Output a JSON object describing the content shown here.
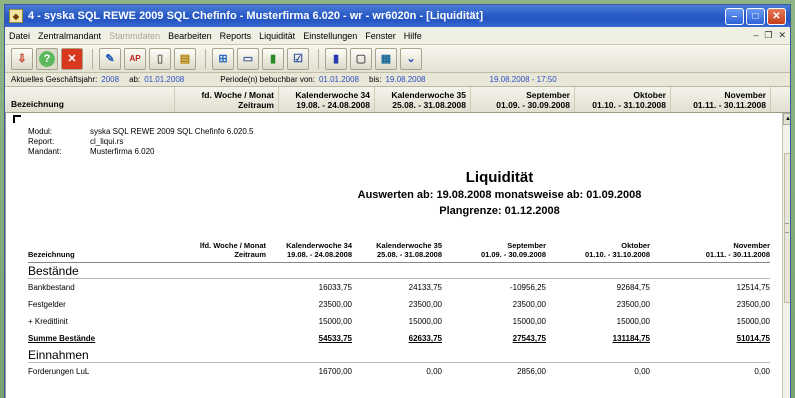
{
  "window": {
    "title": "4 - syska SQL REWE 2009 SQL Chefinfo - Musterfirma 6.020 - wr - wr6020n - [Liquidität]"
  },
  "menu": {
    "items": [
      "Datei",
      "Zentralmandant",
      "Stammdaten",
      "Bearbeiten",
      "Reports",
      "Liquidität",
      "Einstellungen",
      "Fenster",
      "Hilfe"
    ],
    "disabled_index": 2
  },
  "toolbar": {
    "icons": [
      "export-icon",
      "help-icon",
      "close-x-icon",
      "chart-pen-icon",
      "ap-icon",
      "doc-icon",
      "note-icon",
      "grid-icon",
      "window-icon",
      "bar-chart-icon",
      "checkbox-icon",
      "column-icon",
      "page-icon",
      "table-icon",
      "dropdown-circle-icon"
    ]
  },
  "status": {
    "geschaeftsjahr_label": "Aktuelles Geschäftsjahr:",
    "geschaeftsjahr": "2008",
    "ab_label": "ab:",
    "ab": "01.01.2008",
    "periode_label": "Periode(n) bebuchbar von:",
    "periode_von": "01.01.2008",
    "bis_label": "bis:",
    "periode_bis": "19.08.2008",
    "timestamp": "19.08.2008 - 17:50"
  },
  "grid_header": {
    "first": "Bezeichnung",
    "cols": [
      {
        "line1": "fd. Woche / Monat",
        "line2": "Zeitraum"
      },
      {
        "line1": "Kalenderwoche 34",
        "line2": "19.08. - 24.08.2008"
      },
      {
        "line1": "Kalenderwoche 35",
        "line2": "25.08. - 31.08.2008"
      },
      {
        "line1": "September",
        "line2": "01.09. - 30.09.2008"
      },
      {
        "line1": "Oktober",
        "line2": "01.10. - 31.10.2008"
      },
      {
        "line1": "November",
        "line2": "01.11. - 30.11.2008"
      }
    ]
  },
  "report": {
    "meta": {
      "modul_label": "Modul:",
      "modul": "syska SQL REWE 2009 SQL Chefinfo 6.020.5",
      "report_label": "Report:",
      "report": "cl_liqui.rs",
      "mandant_label": "Mandant:",
      "mandant": "Musterfirma 6.020"
    },
    "title": "Liquidität",
    "subtitle": "Auswerten ab: 19.08.2008 monatsweise ab: 01.09.2008",
    "plangrenze": "Plangrenze: 01.12.2008",
    "table_header": {
      "first": "Bezeichnung",
      "cols": [
        {
          "line1": "lfd. Woche / Monat",
          "line2": "Zeitraum"
        },
        {
          "line1": "Kalenderwoche 34",
          "line2": "19.08. - 24.08.2008"
        },
        {
          "line1": "Kalenderwoche 35",
          "line2": "25.08. - 31.08.2008"
        },
        {
          "line1": "September",
          "line2": "01.09. - 30.09.2008"
        },
        {
          "line1": "Oktober",
          "line2": "01.10. - 31.10.2008"
        },
        {
          "line1": "November",
          "line2": "01.11. - 30.11.2008"
        }
      ]
    },
    "sections": [
      {
        "name": "Bestände",
        "rows": [
          {
            "label": "Bankbestand",
            "values": [
              "",
              "16033,75",
              "24133,75",
              "-10956,25",
              "92684,75",
              "12514,75"
            ]
          },
          {
            "label": "Festgelder",
            "values": [
              "",
              "23500,00",
              "23500,00",
              "23500,00",
              "23500,00",
              "23500,00"
            ]
          },
          {
            "label": "+ Kreditlinit",
            "values": [
              "",
              "15000,00",
              "15000,00",
              "15000,00",
              "15000,00",
              "15000,00"
            ]
          }
        ],
        "sum": {
          "label": "Summe Bestände",
          "values": [
            "",
            "54533,75",
            "62633,75",
            "27543,75",
            "131184,75",
            "51014,75"
          ]
        }
      },
      {
        "name": "Einnahmen",
        "rows": [
          {
            "label": "Forderungen LuL",
            "values": [
              "",
              "16700,00",
              "0,00",
              "2856,00",
              "0,00",
              "0,00"
            ]
          }
        ]
      }
    ]
  }
}
